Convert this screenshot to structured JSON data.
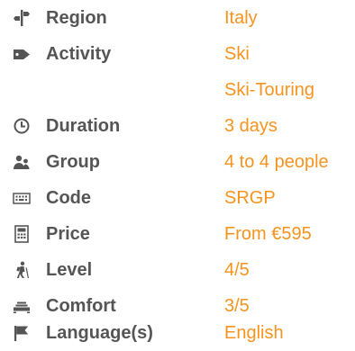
{
  "accent_color": "#f7931e",
  "label_color": "#555555",
  "rows": [
    {
      "icon": "signpost-icon",
      "label": "Region",
      "value": "Italy"
    },
    {
      "icon": "tag-icon",
      "label": "Activity",
      "value": "Ski",
      "value2": "Ski-Touring"
    },
    {
      "icon": "clock-icon",
      "label": "Duration",
      "value": "3 days"
    },
    {
      "icon": "group-icon",
      "label": "Group",
      "value": "4 to 4 people"
    },
    {
      "icon": "keyboard-icon",
      "label": "Code",
      "value": "SRGP"
    },
    {
      "icon": "calculator-icon",
      "label": "Price",
      "value": "From €595"
    },
    {
      "icon": "hiker-icon",
      "label": "Level",
      "value": "4/5"
    },
    {
      "icon": "bed-icon",
      "label": "Comfort",
      "value": "3/5"
    },
    {
      "icon": "flag-icon",
      "label": "Language(s)",
      "value": "English"
    }
  ]
}
